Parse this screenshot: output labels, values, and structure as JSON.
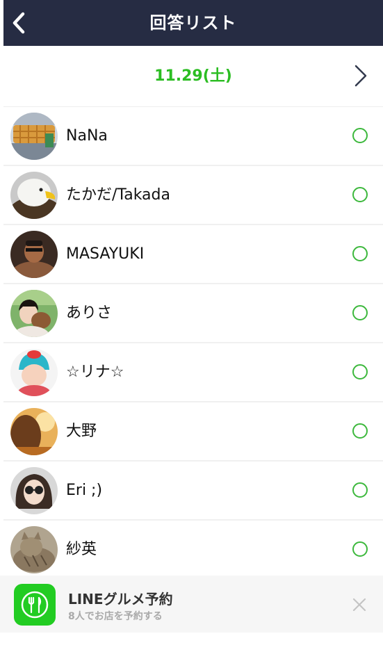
{
  "header": {
    "title": "回答リスト",
    "back_icon": "chevron-left-icon"
  },
  "date_nav": {
    "date": "11.29(土)",
    "next_icon": "chevron-right-icon",
    "accent_color": "#2bbd22"
  },
  "members": [
    {
      "name": "NaNa",
      "status": "available",
      "avatar": "waffle-photo"
    },
    {
      "name": "たかだ/Takada",
      "status": "available",
      "avatar": "eagle-photo"
    },
    {
      "name": "MASAYUKI",
      "status": "available",
      "avatar": "man-photo"
    },
    {
      "name": "ありさ",
      "status": "available",
      "avatar": "woman-with-dog-photo"
    },
    {
      "name": " ☆リナ☆",
      "status": "available",
      "avatar": "baby-photo"
    },
    {
      "name": "大野",
      "status": "available",
      "avatar": "sunset-girl-photo"
    },
    {
      "name": " Eri ;)",
      "status": "available",
      "avatar": "sunglasses-girl-photo"
    },
    {
      "name": " 紗英",
      "status": "available",
      "avatar": "cat-photo"
    }
  ],
  "status_icon": "circle-available-icon",
  "banner": {
    "title": "LINEグルメ予約",
    "subtitle": "8人でお店を予約する",
    "icon": "fork-knife-icon",
    "close_icon": "close-icon",
    "icon_color": "#22cc22"
  }
}
